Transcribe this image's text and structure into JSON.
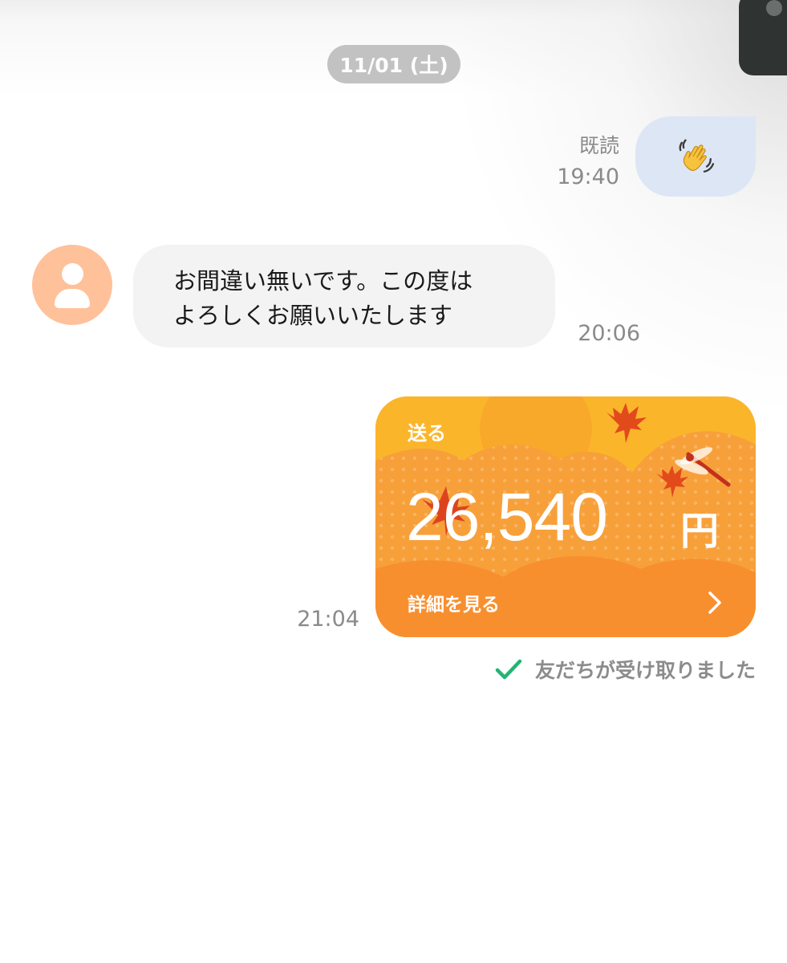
{
  "colors": {
    "date_pill": "#c2c2c2",
    "sent_bubble": "#dde6f4",
    "received_bubble": "#f3f3f3",
    "avatar": "#ffc19a",
    "card_orange": "#f88f2f",
    "card_yellow": "#fbb52b",
    "check_green": "#22b573"
  },
  "date_separator": "11/01 (土)",
  "messages": [
    {
      "direction": "sent",
      "type": "emoji",
      "icon": "waving-hand-icon",
      "read_label": "既読",
      "time": "19:40"
    },
    {
      "direction": "received",
      "type": "text",
      "avatar_icon": "default-user-icon",
      "lines": [
        "お間違い無いです。この度は",
        "よろしくお願いいたします"
      ],
      "time": "20:06"
    },
    {
      "direction": "sent",
      "type": "payment",
      "card_label": "送る",
      "amount": "26,540",
      "currency": "円",
      "detail_label": "詳細を見る",
      "time": "21:04",
      "status_icon": "check-icon",
      "status_text": "友だちが受け取りました"
    }
  ]
}
